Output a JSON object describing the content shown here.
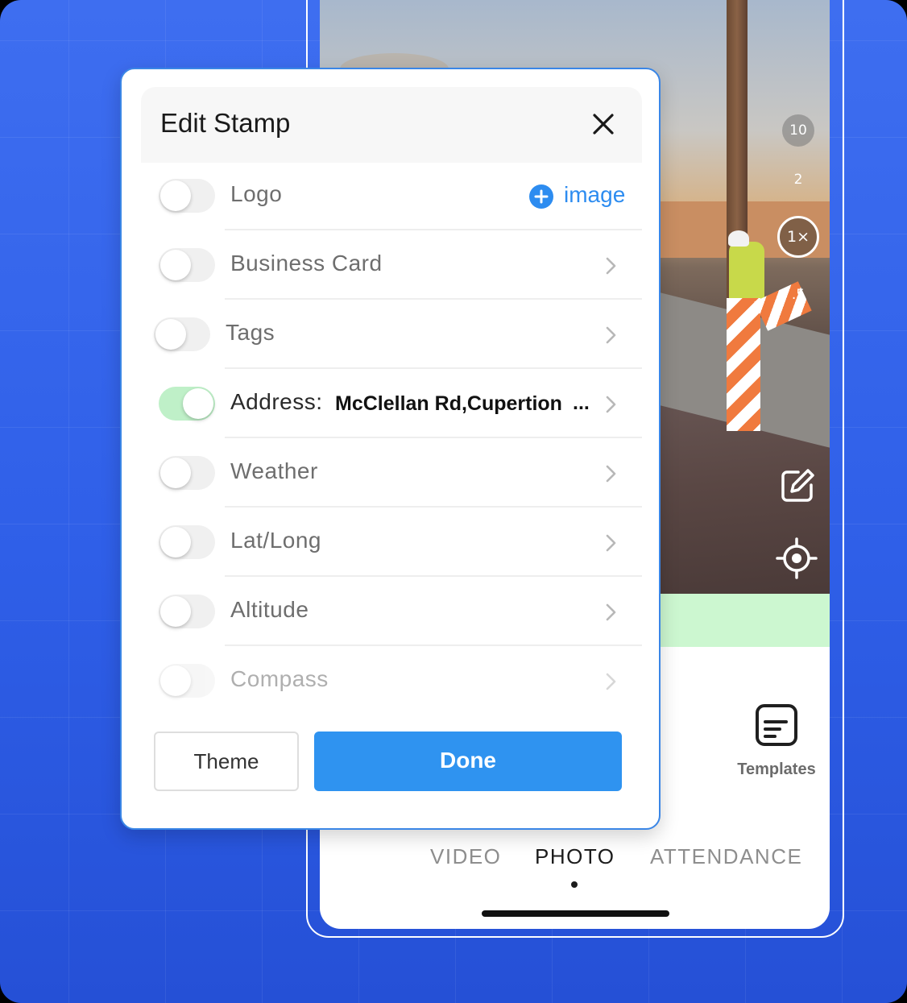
{
  "modal": {
    "title": "Edit Stamp",
    "close_icon": "close-icon",
    "rows": [
      {
        "label": "Logo",
        "enabled": false,
        "action_label": "image",
        "action_icon": "plus-circle-icon"
      },
      {
        "label": "Business Card",
        "enabled": false
      },
      {
        "label": "Tags",
        "enabled": false
      },
      {
        "label": "Address:",
        "enabled": true,
        "value": "McClellan Rd,Cupertion",
        "ellipsis": "..."
      },
      {
        "label": "Weather",
        "enabled": false
      },
      {
        "label": "Lat/Long",
        "enabled": false
      },
      {
        "label": "Altitude",
        "enabled": false
      },
      {
        "label": "Compass",
        "enabled": false
      }
    ],
    "theme_label": "Theme",
    "done_label": "Done",
    "colors": {
      "accent": "#2f93f0",
      "toggle_on": "#bff0c8",
      "border": "#3a86e6"
    }
  },
  "camera": {
    "zoom_levels": [
      "10",
      "2",
      "1×",
      ".5"
    ],
    "active_zoom": "1×",
    "edit_icon": "edit-icon",
    "location_icon": "crosshair-icon"
  },
  "bottom_panel": {
    "templates_label": "Templates",
    "templates_icon": "templates-icon",
    "modes": [
      "VIDEO",
      "PHOTO",
      "ATTENDANCE"
    ],
    "active_mode": "PHOTO"
  }
}
